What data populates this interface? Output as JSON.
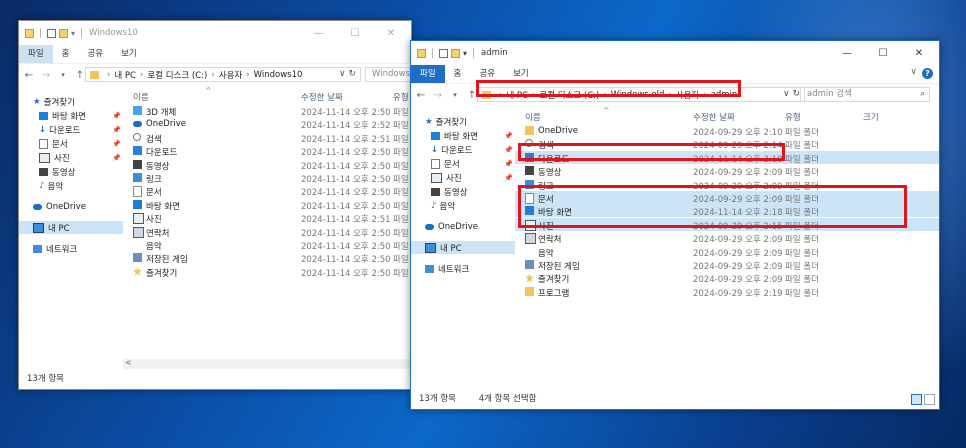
{
  "desktop": {
    "background_accent": "#0c68c9"
  },
  "win1": {
    "title": "Windows10",
    "tabs": [
      "파일",
      "홈",
      "공유",
      "보기"
    ],
    "breadcrumb": [
      "내 PC",
      "로컬 디스크 (C:)",
      "사용자",
      "Windows10"
    ],
    "search_placeholder": "Windows10",
    "columns": [
      "이름",
      "수정한 날짜",
      "유형"
    ],
    "nav": [
      {
        "label": "즐겨찾기",
        "icon": "star-icon"
      },
      {
        "label": "바탕 화면",
        "icon": "desktop-icon",
        "pinned": true
      },
      {
        "label": "다운로드",
        "icon": "download-icon",
        "pinned": true
      },
      {
        "label": "문서",
        "icon": "document-icon",
        "pinned": true
      },
      {
        "label": "사진",
        "icon": "picture-icon",
        "pinned": true
      },
      {
        "label": "동영상",
        "icon": "video-icon"
      },
      {
        "label": "음악",
        "icon": "music-icon"
      },
      {
        "label": "OneDrive",
        "icon": "cloud-icon"
      },
      {
        "label": "내 PC",
        "icon": "pc-icon",
        "selected": true
      },
      {
        "label": "네트워크",
        "icon": "network-icon"
      }
    ],
    "files": [
      {
        "name": "3D 개체",
        "date": "2024-11-14 오후 2:50",
        "type": "파일",
        "icon": "3d-objects-icon"
      },
      {
        "name": "OneDrive",
        "date": "2024-11-14 오후 2:52",
        "type": "파일",
        "icon": "cloud-icon"
      },
      {
        "name": "검색",
        "date": "2024-11-14 오후 2:51",
        "type": "파일",
        "icon": "search-icon"
      },
      {
        "name": "다운로드",
        "date": "2024-11-14 오후 2:50",
        "type": "파일",
        "icon": "download-icon"
      },
      {
        "name": "동영상",
        "date": "2024-11-14 오후 2:50",
        "type": "파일",
        "icon": "video-icon"
      },
      {
        "name": "링크",
        "date": "2024-11-14 오후 2:50",
        "type": "파일",
        "icon": "link-icon"
      },
      {
        "name": "문서",
        "date": "2024-11-14 오후 2:50",
        "type": "파일",
        "icon": "document-icon"
      },
      {
        "name": "바탕 화면",
        "date": "2024-11-14 오후 2:50",
        "type": "파일",
        "icon": "desktop-icon"
      },
      {
        "name": "사진",
        "date": "2024-11-14 오후 2:51",
        "type": "파일",
        "icon": "picture-icon"
      },
      {
        "name": "연락처",
        "date": "2024-11-14 오후 2:50",
        "type": "파일",
        "icon": "contacts-icon"
      },
      {
        "name": "음악",
        "date": "2024-11-14 오후 2:50",
        "type": "파일",
        "icon": "music-icon"
      },
      {
        "name": "저장된 게임",
        "date": "2024-11-14 오후 2:50",
        "type": "파일",
        "icon": "saved-games-icon"
      },
      {
        "name": "즐겨찾기",
        "date": "2024-11-14 오후 2:50",
        "type": "파일",
        "icon": "star-icon"
      }
    ],
    "status": "13개 항목"
  },
  "win2": {
    "title": "admin",
    "tabs": [
      "파일",
      "홈",
      "공유",
      "보기"
    ],
    "breadcrumb": [
      "내 PC",
      "로컬 디스크 (C:)",
      "Windows.old",
      "사용자",
      "admin"
    ],
    "search_placeholder": "admin 검색",
    "columns": [
      "이름",
      "수정한 날짜",
      "유형",
      "크기"
    ],
    "nav": [
      {
        "label": "즐겨찾기",
        "icon": "star-icon"
      },
      {
        "label": "바탕 화면",
        "icon": "desktop-icon",
        "pinned": true
      },
      {
        "label": "다운로드",
        "icon": "download-icon",
        "pinned": true
      },
      {
        "label": "문서",
        "icon": "document-icon",
        "pinned": true
      },
      {
        "label": "사진",
        "icon": "picture-icon",
        "pinned": true
      },
      {
        "label": "동영상",
        "icon": "video-icon"
      },
      {
        "label": "음악",
        "icon": "music-icon"
      },
      {
        "label": "OneDrive",
        "icon": "cloud-icon"
      },
      {
        "label": "내 PC",
        "icon": "pc-icon",
        "selected": true
      },
      {
        "label": "네트워크",
        "icon": "network-icon"
      }
    ],
    "files": [
      {
        "name": "OneDrive",
        "date": "2024-09-29 오후 2:10",
        "type": "파일 폴더",
        "icon": "folder-icon"
      },
      {
        "name": "검색",
        "date": "2024-09-29 오후 2:14",
        "type": "파일 폴더",
        "icon": "search-icon"
      },
      {
        "name": "다운로드",
        "date": "2024-11-14 오후 2:10",
        "type": "파일 폴더",
        "icon": "download-icon",
        "selected": true
      },
      {
        "name": "동영상",
        "date": "2024-09-29 오후 2:09",
        "type": "파일 폴더",
        "icon": "video-icon"
      },
      {
        "name": "링크",
        "date": "2024-09-29 오후 2:09",
        "type": "파일 폴더",
        "icon": "link-icon"
      },
      {
        "name": "문서",
        "date": "2024-09-29 오후 2:09",
        "type": "파일 폴더",
        "icon": "document-icon",
        "selected": true
      },
      {
        "name": "바탕 화면",
        "date": "2024-11-14 오후 2:18",
        "type": "파일 폴더",
        "icon": "desktop-icon",
        "selected": true
      },
      {
        "name": "사진",
        "date": "2024-09-29 오후 2:15",
        "type": "파일 폴더",
        "icon": "picture-icon",
        "selected": true
      },
      {
        "name": "연락처",
        "date": "2024-09-29 오후 2:09",
        "type": "파일 폴더",
        "icon": "contacts-icon"
      },
      {
        "name": "음악",
        "date": "2024-09-29 오후 2:09",
        "type": "파일 폴더",
        "icon": "music-icon"
      },
      {
        "name": "저장된 게임",
        "date": "2024-09-29 오후 2:09",
        "type": "파일 폴더",
        "icon": "saved-games-icon"
      },
      {
        "name": "즐겨찾기",
        "date": "2024-09-29 오후 2:09",
        "type": "파일 폴더",
        "icon": "star-icon"
      },
      {
        "name": "프로그램",
        "date": "2024-09-29 오후 2:19",
        "type": "파일 폴더",
        "icon": "folder-icon"
      }
    ],
    "status_count": "13개 항목",
    "status_selected": "4개 항목 선택함"
  }
}
